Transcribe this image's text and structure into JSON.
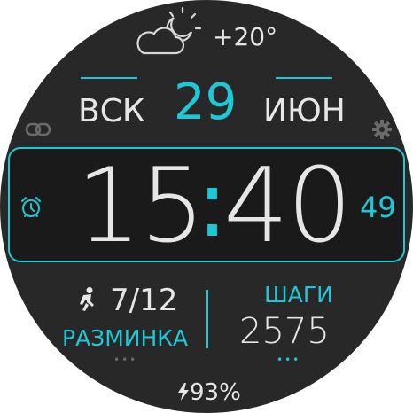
{
  "colors": {
    "accent": "#1ec8d6",
    "background": "#282828",
    "text": "#e6e6e6",
    "muted": "#6a6a6a"
  },
  "weather": {
    "icon": "partly-cloudy-night-icon",
    "temperature": "+20°"
  },
  "date": {
    "weekday": "ВСК",
    "day": "29",
    "month": "ИЮН"
  },
  "icons": {
    "left": "link-icon",
    "right": "gear-icon",
    "alarm": "alarm-clock-icon",
    "activity": "running-man-icon",
    "battery": "bolt-icon"
  },
  "time": {
    "hours": "15",
    "separator": ":",
    "minutes": "40",
    "seconds": "49"
  },
  "warmup": {
    "value": "7/12",
    "label": "РАЗМИНКА",
    "more": "•••"
  },
  "steps": {
    "label": "ШАГИ",
    "value": "2575",
    "more": "•••"
  },
  "battery": {
    "value": "93%"
  }
}
